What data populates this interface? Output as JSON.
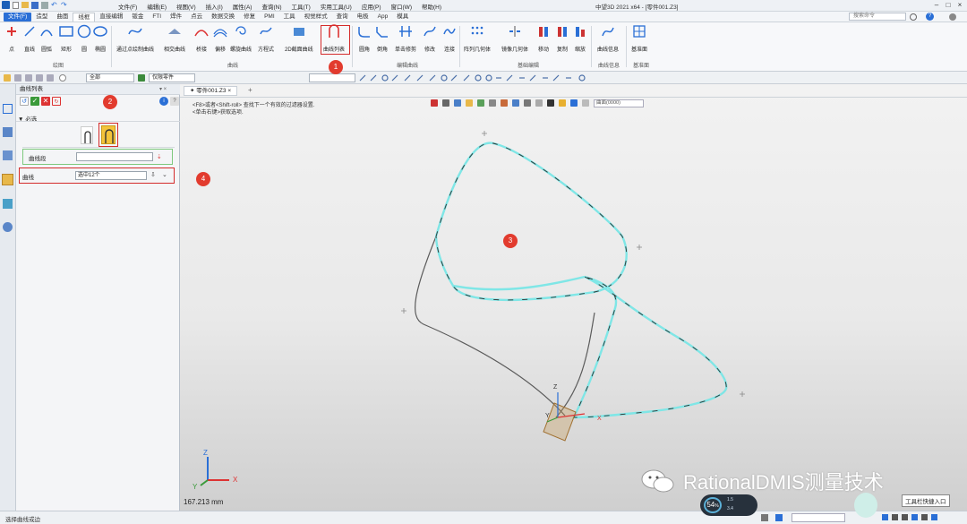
{
  "titlebar": {
    "menu": [
      "文件(F)",
      "编辑(E)",
      "视图(V)",
      "插入(I)",
      "属性(A)",
      "查询(N)",
      "工具(T)",
      "实用工具(U)",
      "应用(P)",
      "窗口(W)",
      "帮助(H)"
    ],
    "title": "中望3D 2021 x64 - [零件001.Z3]"
  },
  "ribbon_tabs": [
    "文件(F)",
    "造型",
    "曲面",
    "线框",
    "直接编辑",
    "钣金",
    "FTI",
    "焊件",
    "点云",
    "数据交换",
    "修复",
    "PMI",
    "工具",
    "视觉样式",
    "查询",
    "电极",
    "App",
    "模具"
  ],
  "search_placeholder": "搜索命令",
  "ribbon": {
    "buttons": [
      "点",
      "直线",
      "圆弧",
      "矩形",
      "圆",
      "椭圆",
      "通过点绘制曲线",
      "相交曲线",
      "桥接",
      "偏移",
      "螺旋曲线",
      "方程式",
      "2D截面曲线",
      "曲线列表",
      "圆角",
      "倒角",
      "单击修剪",
      "修改",
      "连接",
      "阵列几何体",
      "镜像几何体",
      "移动",
      "复制",
      "缩放",
      "曲线信息",
      "基准面"
    ],
    "groups": [
      "绘图",
      "曲线",
      "编辑曲线",
      "基础编辑",
      "曲线信息",
      "基准面"
    ]
  },
  "toolbar": {
    "filter": "全部",
    "scope": "仅限零件"
  },
  "panel": {
    "title": "曲线列表",
    "section": "必选",
    "curve_field_label": "曲线段",
    "curve_field_value": "",
    "curve_label": "曲线",
    "curve_value": "选中12个"
  },
  "viewport": {
    "tab": "零件001.Z3",
    "hint1": "<F8>或者<Shift-roll> 查找下一个有效的过滤器设置.",
    "hint2": "<单击右键>获取选项.",
    "measure": "167.213 mm",
    "zoom_box": "曲面(0000)",
    "axis_x": "X",
    "axis_y": "Y",
    "axis_z": "Z"
  },
  "callouts": [
    "1",
    "2",
    "3",
    "4"
  ],
  "status": {
    "text": "选择曲线或边",
    "gauge": "54",
    "gauge_unit": "%",
    "up": "1.5",
    "down": "3.4",
    "tooltip": "工具栏快捷入口"
  },
  "watermark": "RationalDMIS测量技术",
  "colors": {
    "accent": "#2a6fd6",
    "callout": "#e23b2e",
    "curve_selected": "#7fe6e6",
    "curve_default": "#555555"
  }
}
